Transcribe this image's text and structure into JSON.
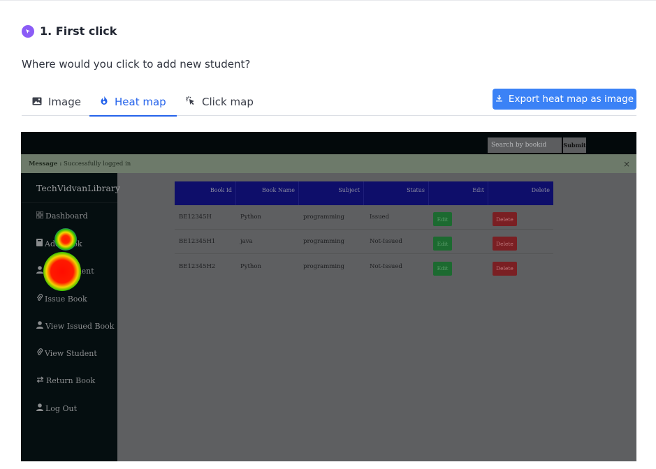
{
  "question": {
    "number_title": "1. First click",
    "text": "Where would you click to add new student?"
  },
  "tabs": [
    {
      "label": "Image",
      "icon": "image-icon",
      "active": false
    },
    {
      "label": "Heat map",
      "icon": "flame-icon",
      "active": true
    },
    {
      "label": "Click map",
      "icon": "cursor-click-icon",
      "active": false
    }
  ],
  "export_button": {
    "label": "Export heat map as image",
    "icon": "download-icon"
  },
  "colors": {
    "accent": "#2563eb",
    "button": "#3b82f6",
    "badge": "#8b5cf6"
  },
  "screenshot": {
    "search_placeholder": "Search by bookid",
    "search_button": "Submit",
    "message_label": "Message :",
    "message_text": "Successfully logged in",
    "close_glyph": "×",
    "brand": "TechVidvanLibrary",
    "sidebar": [
      {
        "label": "Dashboard",
        "icon": "dashboard-icon"
      },
      {
        "label": "Add Book",
        "icon": "book-icon"
      },
      {
        "label": "Add Student",
        "icon": "user-icon"
      },
      {
        "label": "Issue Book",
        "icon": "paperclip-icon"
      },
      {
        "label": "View Issued Book",
        "icon": "user-icon"
      },
      {
        "label": "View Student",
        "icon": "paperclip-icon"
      },
      {
        "label": "Return Book",
        "icon": "exchange-icon"
      },
      {
        "label": "Log Out",
        "icon": "user-icon"
      }
    ],
    "table": {
      "headers": [
        "Book Id",
        "Book Name",
        "Subject",
        "Status",
        "Edit",
        "Delete"
      ],
      "rows": [
        {
          "id": "BE12345H",
          "name": "Python",
          "subject": "programming",
          "status": "Issued",
          "edit": "Edit",
          "delete": "Delete"
        },
        {
          "id": "BE12345H1",
          "name": "java",
          "subject": "programming",
          "status": "Not-Issued",
          "edit": "Edit",
          "delete": "Delete"
        },
        {
          "id": "BE12345H2",
          "name": "Python",
          "subject": "programming",
          "status": "Not-Issued",
          "edit": "Edit",
          "delete": "Delete"
        }
      ]
    }
  }
}
